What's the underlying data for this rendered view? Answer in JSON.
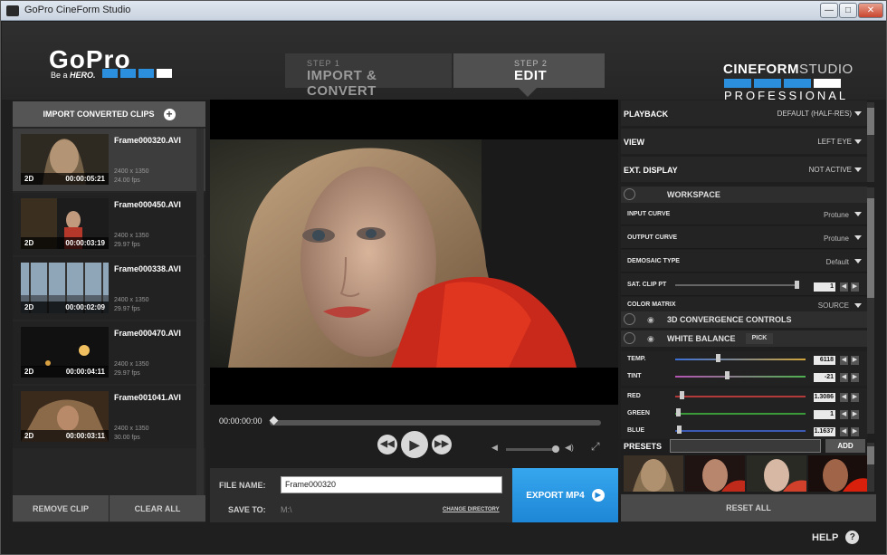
{
  "window": {
    "title": "GoPro CineForm Studio",
    "minimize": "—",
    "maximize": "□",
    "close": "✕"
  },
  "header": {
    "logo": "GoPro",
    "tagline_prefix": "Be a",
    "tagline_em": "HERO.",
    "step1": {
      "num": "STEP 1",
      "label": "IMPORT & CONVERT"
    },
    "step2": {
      "num": "STEP 2",
      "label": "EDIT"
    },
    "cine_a": "CINEFORM",
    "cine_b": "STUDIO",
    "pro": "PROFESSIONAL"
  },
  "left": {
    "import_label": "IMPORT CONVERTED CLIPS",
    "clips": [
      {
        "name": "Frame000320.AVI",
        "mode": "2D",
        "time": "00:00:05:21",
        "res": "2400 x 1350",
        "fps": "24.00 fps"
      },
      {
        "name": "Frame000450.AVI",
        "mode": "2D",
        "time": "00:00:03:19",
        "res": "2400 x 1350",
        "fps": "29.97 fps"
      },
      {
        "name": "Frame000338.AVI",
        "mode": "2D",
        "time": "00:00:02:09",
        "res": "2400 x 1350",
        "fps": "29.97 fps"
      },
      {
        "name": "Frame000470.AVI",
        "mode": "2D",
        "time": "00:00:04:11",
        "res": "2400 x 1350",
        "fps": "29.97 fps"
      },
      {
        "name": "Frame001041.AVI",
        "mode": "2D",
        "time": "00:00:03:11",
        "res": "2400 x 1350",
        "fps": "30.00 fps"
      }
    ],
    "remove": "REMOVE CLIP",
    "clear": "CLEAR ALL"
  },
  "player": {
    "timecode": "00:00:00:00",
    "file_name_label": "FILE NAME:",
    "file_name": "Frame000320",
    "save_to_label": "SAVE TO:",
    "save_path": "M:\\",
    "change_dir": "CHANGE DIRECTORY",
    "export": "EXPORT MP4"
  },
  "settings": {
    "playback": {
      "label": "PLAYBACK",
      "value": "DEFAULT (HALF-RES)"
    },
    "view": {
      "label": "VIEW",
      "value": "LEFT EYE"
    },
    "ext": {
      "label": "EXT. DISPLAY",
      "value": "NOT ACTIVE"
    },
    "workspace": "WORKSPACE",
    "input_curve": {
      "label": "INPUT CURVE",
      "value": "Protune"
    },
    "output_curve": {
      "label": "OUTPUT CURVE",
      "value": "Protune"
    },
    "demosaic": {
      "label": "DEMOSAIC TYPE",
      "value": "Default"
    },
    "sat_clip": {
      "label": "SAT. CLIP PT",
      "value": "1"
    },
    "color_matrix": {
      "label": "COLOR MATRIX",
      "value": "SOURCE"
    },
    "convergence": "3D CONVERGENCE CONTROLS",
    "white_balance": "WHITE BALANCE",
    "pick": "PICK",
    "temp": {
      "label": "TEMP.",
      "value": "6118"
    },
    "tint": {
      "label": "TINT",
      "value": "-21"
    },
    "red": {
      "label": "RED",
      "value": "1.3086"
    },
    "green": {
      "label": "GREEN",
      "value": "1"
    },
    "blue": {
      "label": "BLUE",
      "value": "1.1637"
    }
  },
  "presets": {
    "label": "PRESETS",
    "add": "ADD"
  },
  "reset": "RESET ALL",
  "help": "HELP",
  "help_icon": "?"
}
